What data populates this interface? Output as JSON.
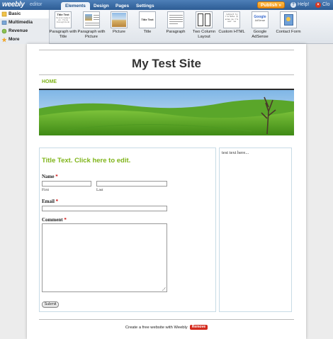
{
  "app": {
    "logo": "weebly",
    "logo_sub": "editor",
    "tabs": [
      {
        "label": "Elements",
        "active": true
      },
      {
        "label": "Design",
        "active": false
      },
      {
        "label": "Pages",
        "active": false
      },
      {
        "label": "Settings",
        "active": false
      }
    ],
    "publish_label": "Publish »",
    "help_label": "Help!",
    "close_label": "Clo"
  },
  "categories": [
    {
      "label": "Basic",
      "icon": "basic-icon",
      "active": true
    },
    {
      "label": "Multimedia",
      "icon": "multimedia-icon",
      "active": false
    },
    {
      "label": "Revenue",
      "icon": "revenue-icon",
      "active": false
    },
    {
      "label": "More",
      "icon": "more-icon",
      "active": false
    }
  ],
  "elements": [
    {
      "label": "Paragraph with Title",
      "thumb_title": "Title Text",
      "thumb_text": "Sit amet neglig in vel... The lig thorough the ab"
    },
    {
      "label": "Paragraph with Picture",
      "thumb_title": "",
      "thumb_text": ""
    },
    {
      "label": "Picture",
      "thumb_title": "",
      "thumb_text": ""
    },
    {
      "label": "Title",
      "thumb_title": "Title Text",
      "thumb_text": ""
    },
    {
      "label": "Paragraph",
      "thumb_title": "",
      "thumb_text": ""
    },
    {
      "label": "Two Column Layout",
      "thumb_title": "",
      "thumb_text": ""
    },
    {
      "label": "Custom HTML",
      "thumb_title": "",
      "thumb_text": "<object ty ='m.ddla <param na ='move' va"
    },
    {
      "label": "Google AdSense",
      "thumb_title": "Google",
      "thumb_text": "AdSense"
    },
    {
      "label": "Contact Form",
      "thumb_title": "",
      "thumb_text": ""
    }
  ],
  "site": {
    "title": "My Test Site",
    "nav": [
      "HOME"
    ],
    "right_text": "test text here...",
    "form": {
      "title": "Title Text. Click here to edit.",
      "name_label": "Name",
      "first_label": "First",
      "last_label": "Last",
      "email_label": "Email",
      "comment_label": "Comment",
      "required_mark": "*",
      "submit_label": "Submit"
    },
    "footer_text": "Create a free website with Weebly",
    "remove_label": "Remove"
  },
  "colors": {
    "brand_blue": "#2d5c94",
    "accent_green": "#7fb419",
    "publish_orange": "#ef8e12",
    "remove_red": "#d42a1e"
  }
}
